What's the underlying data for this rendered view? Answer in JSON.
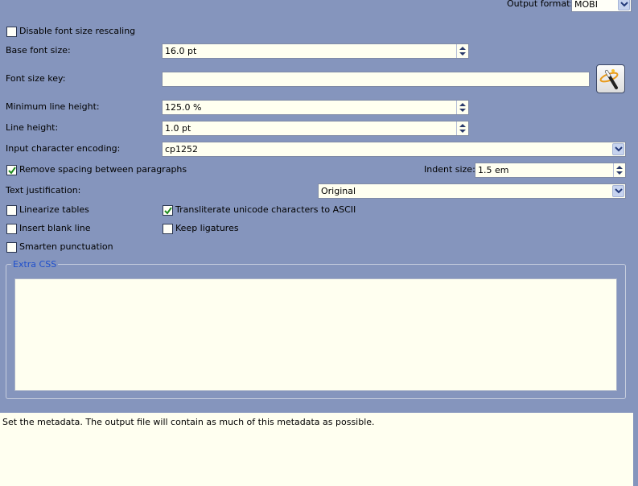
{
  "output_format": {
    "label": "Output format:",
    "value": "MOBI"
  },
  "disable_font_rescaling": {
    "label": "Disable font size rescaling",
    "checked": false
  },
  "base_font_size": {
    "label": "Base font size:",
    "value": "16.0 pt"
  },
  "font_size_key": {
    "label": "Font size key:",
    "value": "",
    "wizard_icon": "magic-wand-icon"
  },
  "min_line_height": {
    "label": "Minimum line height:",
    "value": "125.0 %"
  },
  "line_height": {
    "label": "Line height:",
    "value": "1.0 pt"
  },
  "input_encoding": {
    "label": "Input character encoding:",
    "value": "cp1252"
  },
  "remove_spacing": {
    "label": "Remove spacing between paragraphs",
    "checked": true
  },
  "indent_size": {
    "label": "Indent size:",
    "value": "1.5 em"
  },
  "text_justification": {
    "label": "Text justification:",
    "value": "Original"
  },
  "linearize_tables": {
    "label": "Linearize tables",
    "checked": false
  },
  "transliterate": {
    "label": "Transliterate unicode characters to ASCII",
    "checked": true
  },
  "insert_blank_line": {
    "label": "Insert blank line",
    "checked": false
  },
  "keep_ligatures": {
    "label": "Keep ligatures",
    "checked": false
  },
  "smarten_punctuation": {
    "label": "Smarten punctuation",
    "checked": false
  },
  "extra_css": {
    "title": "Extra CSS",
    "value": ""
  },
  "help": {
    "text": "Set the metadata. The output file will contain as much of this metadata as possible."
  },
  "colors": {
    "background": "#8595bd",
    "field": "#fffff0",
    "group_title": "#1f4fcc",
    "check": "#1e8a1e"
  }
}
